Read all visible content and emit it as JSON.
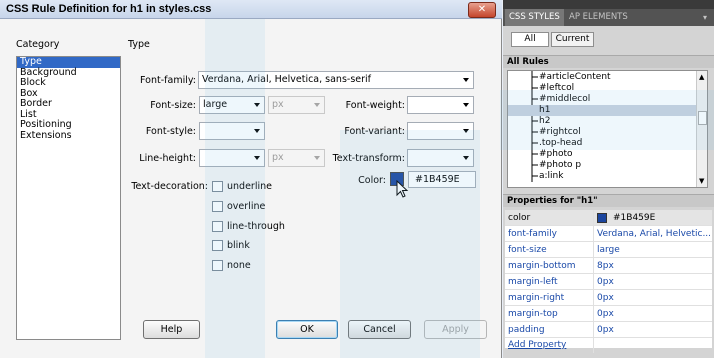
{
  "dialog": {
    "title": "CSS Rule Definition for h1 in styles.css",
    "close_label": "✕",
    "category_header": "Category",
    "section_header": "Type",
    "categories": [
      "Type",
      "Background",
      "Block",
      "Box",
      "Border",
      "List",
      "Positioning",
      "Extensions"
    ],
    "selected_category": "Type",
    "fields": {
      "font_family": {
        "label": "Font-family:",
        "value": "Verdana, Arial, Helvetica, sans-serif"
      },
      "font_size": {
        "label": "Font-size:",
        "value": "large",
        "unit": "px"
      },
      "font_weight": {
        "label": "Font-weight:",
        "value": ""
      },
      "font_style": {
        "label": "Font-style:",
        "value": ""
      },
      "font_variant": {
        "label": "Font-variant:",
        "value": ""
      },
      "line_height": {
        "label": "Line-height:",
        "value": "",
        "unit": "px"
      },
      "text_transform": {
        "label": "Text-transform:",
        "value": ""
      },
      "text_decoration": {
        "label": "Text-decoration:",
        "options": [
          "underline",
          "overline",
          "line-through",
          "blink",
          "none"
        ]
      },
      "color": {
        "label": "Color:",
        "value": "#1B459E"
      }
    },
    "buttons": {
      "help": "Help",
      "ok": "OK",
      "cancel": "Cancel",
      "apply": "Apply"
    }
  },
  "panel": {
    "tabs": [
      "CSS STYLES",
      "AP ELEMENTS"
    ],
    "modes": [
      "All",
      "Current"
    ],
    "all_rules_header": "All Rules",
    "rules": [
      "#articleContent",
      "#leftcol",
      "#middlecol",
      "h1",
      "h2",
      "#rightcol",
      ".top-head",
      "#photo",
      "#photo p",
      "a:link"
    ],
    "selected_rule": "h1",
    "properties_header": "Properties for \"h1\"",
    "properties": [
      {
        "name": "color",
        "value": "#1B459E"
      },
      {
        "name": "font-family",
        "value": "Verdana, Arial, Helvetic..."
      },
      {
        "name": "font-size",
        "value": "large"
      },
      {
        "name": "margin-bottom",
        "value": "8px"
      },
      {
        "name": "margin-left",
        "value": "0px"
      },
      {
        "name": "margin-right",
        "value": "0px"
      },
      {
        "name": "margin-top",
        "value": "0px"
      },
      {
        "name": "padding",
        "value": "0px"
      }
    ],
    "add_property": "Add Property"
  },
  "colors": {
    "accent": "#1B459E",
    "selection": "#3169c6"
  }
}
